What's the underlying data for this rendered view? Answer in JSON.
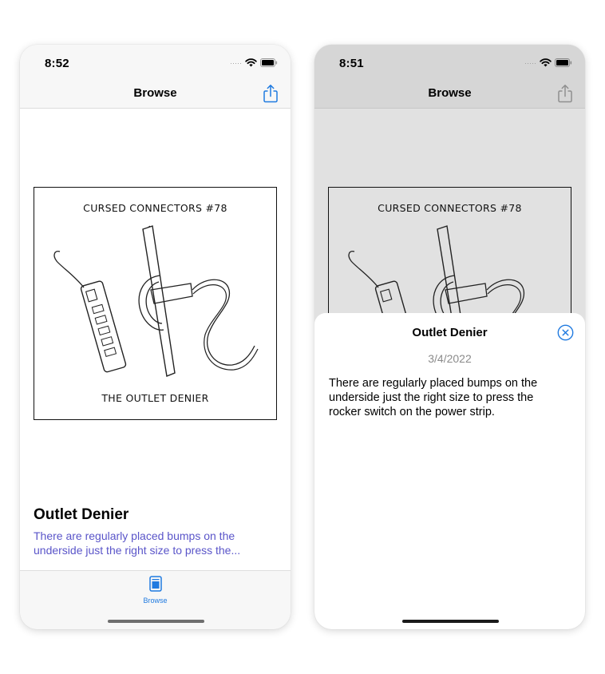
{
  "left_screen": {
    "status": {
      "time": "8:52"
    },
    "nav": {
      "title": "Browse"
    },
    "comic": {
      "title": "CURSED CONNECTORS #78",
      "subtitle": "THE OUTLET DENIER"
    },
    "item": {
      "title": "Outlet Denier",
      "excerpt": "There are regularly placed bumps on the underside just the right size to press the..."
    },
    "tab_bar": {
      "items": [
        {
          "label": "Browse",
          "icon": "browse-icon",
          "selected": true
        }
      ]
    }
  },
  "right_screen": {
    "status": {
      "time": "8:51"
    },
    "nav": {
      "title": "Browse"
    },
    "comic": {
      "title": "CURSED CONNECTORS #78"
    },
    "sheet": {
      "title": "Outlet Denier",
      "date": "3/4/2022",
      "body": "There are regularly placed bumps on the underside just the right size to press the rocker switch on the power strip."
    }
  },
  "colors": {
    "accent": "#1f7ae0",
    "excerpt": "#5a55c9",
    "dim_background": "#e1e1e1",
    "secondary_text": "#8b8b8b"
  }
}
